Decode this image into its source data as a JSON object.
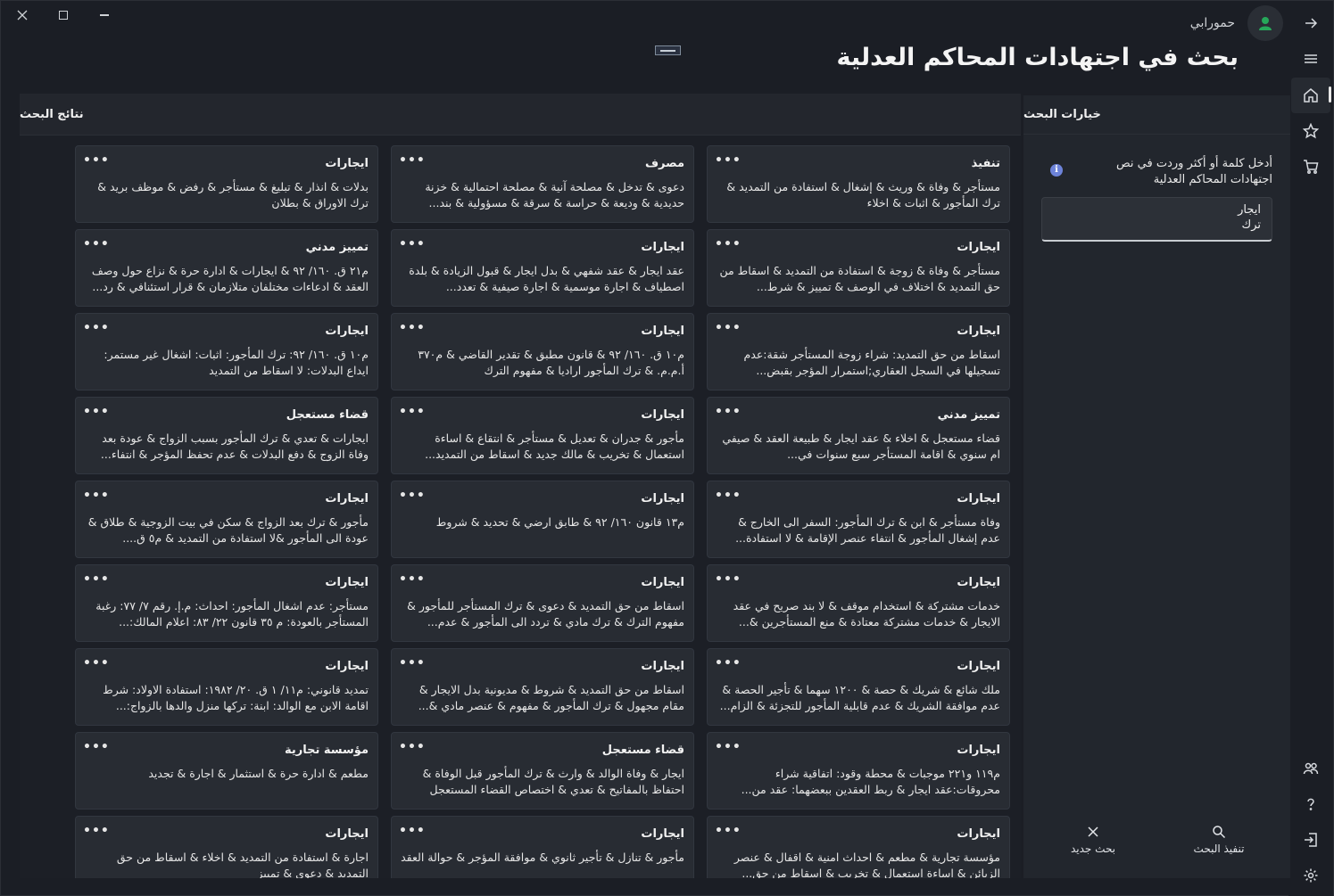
{
  "window": {
    "close_icon": "close-icon",
    "maximize_icon": "maximize-icon",
    "minimize_icon": "minimize-icon"
  },
  "user": {
    "name": "حمورابي"
  },
  "page": {
    "title": "بحث في اجتهادات المحاكم العدلية"
  },
  "rail": {
    "items": [
      "back-arrow-icon",
      "menu-icon",
      "home-icon",
      "star-icon",
      "cart-icon",
      "people-icon",
      "help-icon",
      "logout-icon",
      "settings-icon"
    ]
  },
  "options": {
    "title": "خيارات البحث",
    "help_text": "أدخل كلمة أو أكثر وردت في نص اجتهادات المحاكم العدلية",
    "keywords": "ايجار\nترك",
    "execute_label": "تنفيذ البحث",
    "new_search_label": "بحث جديد"
  },
  "results": {
    "title": "نتائج البحث",
    "cards": [
      {
        "title": "تنفيذ",
        "body": "مستأجر & وفاة & وريث & إشغال & استفادة من التمديد & ترك المأجور & اثبات & اخلاء"
      },
      {
        "title": "مصرف",
        "body": "دعوى & تدخل & مصلحة آنية & مصلحة احتمالية & خزنة حديدية & وديعة & حراسة & سرقة & مسؤولية & بند..."
      },
      {
        "title": "ايجارات",
        "body": "بدلات & انذار & تبليغ & مستأجر & رفض & موظف بريد & ترك الاوراق & بطلان"
      },
      {
        "title": "ايجارات",
        "body": "مستأجر & وفاة & زوجة & استفادة من التمديد & اسقاط من حق التمديد & اختلاف في الوصف & تمييز & شرط..."
      },
      {
        "title": "ايجارات",
        "body": "عقد ايجار & عقد شفهي & بدل ايجار & قبول الزيادة & بلدة اصطياف & اجارة موسمية & اجارة صيفية & تعدد..."
      },
      {
        "title": "تمييز مدني",
        "body": "م٢١ ق. ١٦٠/ ٩٢ & ايجارات & ادارة حرة & نزاع حول وصف العقد & ادعاءات مختلفان متلازمان & قرار استئنافي & رد..."
      },
      {
        "title": "ايجارات",
        "body": "اسقاط من حق التمديد: شراء زوجة المستأجر شقة:عدم تسجيلها في السجل العقاري;استمرار المؤجر بقبض..."
      },
      {
        "title": "ايجارات",
        "body": "م١٠ ق. ١٦٠/ ٩٢ & قانون مطبق & تقدير القاضي & م٣٧٠ أ.م.م. & ترك المأجور اراديا & مفهوم الترك"
      },
      {
        "title": "ايجارات",
        "body": "م١٠ ق. ١٦٠/ ٩٢: ترك المأجور: اثبات: اشغال غير مستمر: ايداع البدلات: لا اسقاط من التمديد"
      },
      {
        "title": "تمييز مدني",
        "body": "قضاء مستعجل & اخلاء & عقد ايجار & طبيعة العقد & صيفي ام سنوي & اقامة المستأجر سبع سنوات في..."
      },
      {
        "title": "ايجارات",
        "body": "مأجور & جدران & تعديل & مستأجر & انتقاع & اساءة استعمال & تخريب & مالك جديد & اسقاط من التمديد..."
      },
      {
        "title": "قضاء مستعجل",
        "body": "ايجارات & تعدي & ترك المأجور بسبب الزواج & عودة بعد وفاة الزوج & دفع البدلات & عدم تحفظ المؤجر & انتفاء..."
      },
      {
        "title": "ايجارات",
        "body": "وفاة مستأجر & ابن & ترك المأجور: السفر الى الخارج & عدم إشغال المأجور & انتفاء عنصر الإقامة & لا استفادة..."
      },
      {
        "title": "ايجارات",
        "body": "م١٣ قانون ١٦٠/ ٩٢ & طابق ارضي & تحديد & شروط"
      },
      {
        "title": "ايجارات",
        "body": "مأجور & ترك بعد الزواج & سكن في بيت الزوجية & طلاق & عودة الى المأجور &لا استفادة من التمديد & م٥ ق...."
      },
      {
        "title": "ايجارات",
        "body": "خدمات مشتركة & استخدام موقف & لا بند صريح في عقد الايجار & خدمات مشتركة معتادة & منع المستأجرين &..."
      },
      {
        "title": "ايجارات",
        "body": "اسقاط من حق التمديد & دعوى & ترك المستأجر للمأجور & مفهوم الترك & ترك مادي & تردد الى المأجور & عدم..."
      },
      {
        "title": "ايجارات",
        "body": "مستأجر: عدم اشغال المأجور: احداث: م.إ. رقم ٧/ ٧٧: رغبة المستأجر بالعودة: م ٣٥ قانون ٢٢/ ٨٣: اعلام المالك:..."
      },
      {
        "title": "ايجارات",
        "body": "ملك شائع & شريك & حصة & ١٢٠٠ سهما & تأجير الحصة & عدم موافقة الشريك & عدم قابلية المأجور للتجزئة & الزام..."
      },
      {
        "title": "ايجارات",
        "body": "اسقاط من حق التمديد & شروط & مديونية بدل الايجار & مقام مجهول & ترك المأجور & مفهوم & عنصر مادي &..."
      },
      {
        "title": "ايجارات",
        "body": "تمديد قانوني: م١١/ ١ ق. ٢٠/ ١٩٨٢: استفادة الاولاد: شرط اقامة الابن مع الوالد: ابنة: تركها منزل والدها بالزواج:..."
      },
      {
        "title": "ايجارات",
        "body": "م١١٩ و٢٢١ موجبات & محطة وقود: اتفاقية شراء محروقات:عقد ايجار & ربط العقدين ببعضهما: عقد من..."
      },
      {
        "title": "قضاء مستعجل",
        "body": "ايجار & وفاة الوالد & وارث & ترك المأجور قبل الوفاة & احتفاظ بالمفاتيح & تعدي & اختصاص القضاء المستعجل"
      },
      {
        "title": "مؤسسة تجارية",
        "body": "مطعم & ادارة حرة & استثمار & اجارة & تجديد"
      },
      {
        "title": "ايجارات",
        "body": "مؤسسة تجارية & مطعم & احداث امنية & اقفال & عنصر الزبائن & اساءة استعمال & تخريب & اسقاط من حق..."
      },
      {
        "title": "ايجارات",
        "body": "مأجور & تنازل & تأجير ثانوي & موافقة المؤجر & حوالة العقد"
      },
      {
        "title": "ايجارات",
        "body": "اجارة & استفادة من التمديد & اخلاء & اسقاط من حق التمديد & دعوى & تمييز"
      }
    ]
  }
}
